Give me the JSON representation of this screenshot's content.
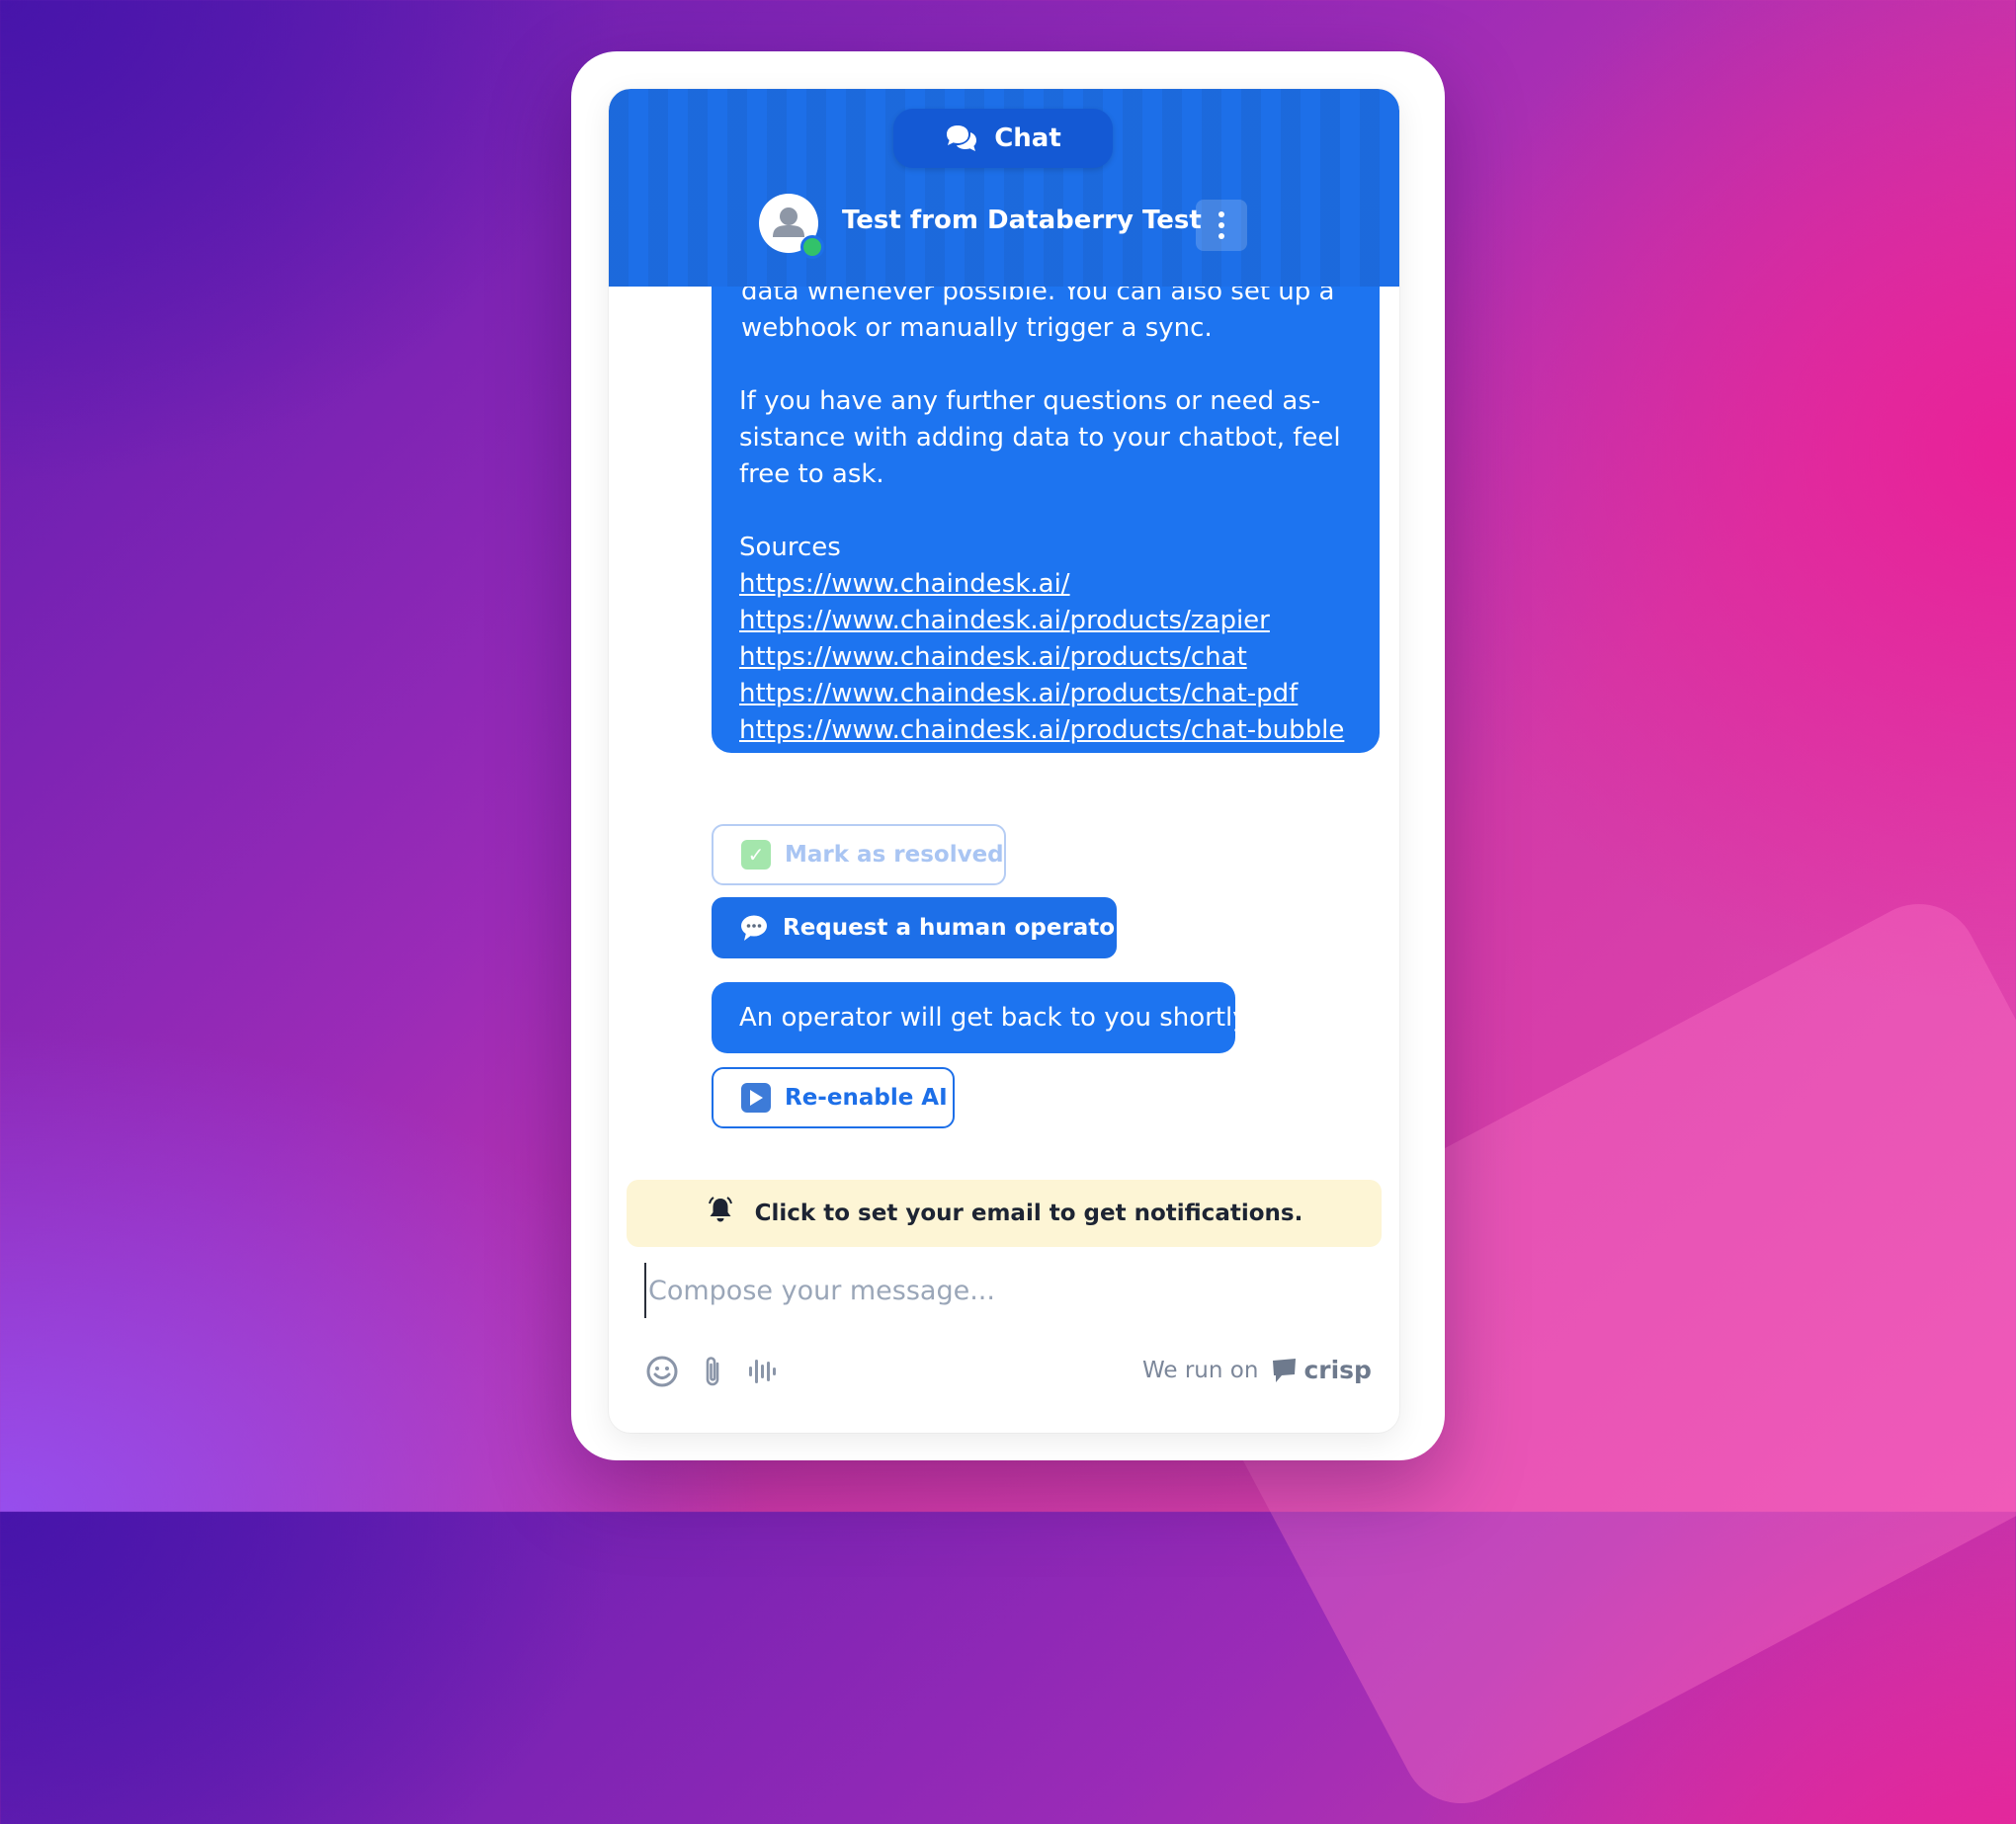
{
  "header": {
    "tab_label": "Chat",
    "operator_name": "Test from Databerry Test"
  },
  "messages": {
    "answer_paragraph_1": "to date with your data. We synchronize your data whenever possible. You can also set up a webhook or manually trigger a sync.",
    "answer_paragraph_2": "If you have any further questions or need as-sistance with adding data to your chatbot, feel free to ask.",
    "sources_label": "Sources",
    "source_links": [
      "https://www.chaindesk.ai/",
      "https://www.chaindesk.ai/products/zapier",
      "https://www.chaindesk.ai/products/chat",
      "https://www.chaindesk.ai/products/chat-pdf",
      "https://www.chaindesk.ai/products/chat-bubble"
    ],
    "operator_reply": "An operator will get back to you shortly."
  },
  "actions": {
    "mark_resolved": "Mark as resolved",
    "request_human": "Request a human operator",
    "reenable_ai": "Re-enable AI",
    "mark_resolved_emoji": "check-mark-icon",
    "request_human_emoji": "speech-bubble-icon",
    "reenable_ai_emoji": "play-icon"
  },
  "notification_banner": {
    "text": "Click to set your email to get notifications.",
    "icon": "bell-icon"
  },
  "composer": {
    "placeholder": "Compose your message...",
    "tools": [
      "emoji-icon",
      "paperclip-icon",
      "voice-icon"
    ]
  },
  "footer": {
    "powered_prefix": "We run on",
    "brand": "crisp"
  },
  "colors": {
    "accent": "#1d6fe8",
    "bubble": "#1d74f0",
    "banner_bg": "#fdf5d5"
  }
}
